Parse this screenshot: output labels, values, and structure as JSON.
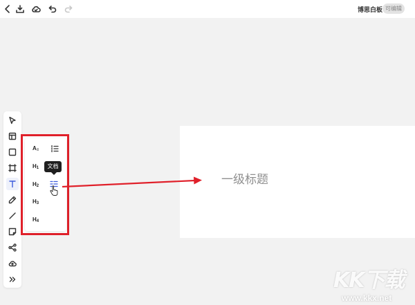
{
  "app": {
    "title": "博思白板",
    "mode_badge": "可编辑"
  },
  "topbar": {
    "icons": [
      "back-icon",
      "download-icon",
      "cloud-icon",
      "undo-icon",
      "redo-icon"
    ]
  },
  "toolbar": {
    "items": [
      "select-icon",
      "frame-icon",
      "shape-icon",
      "crop-icon",
      "text-icon",
      "pen-icon",
      "line-icon",
      "sticky-note-icon",
      "share-icon",
      "upload-icon",
      "more-icon"
    ],
    "active": "text-icon"
  },
  "text_panel": {
    "options": [
      {
        "label": "A",
        "suffix": "≡"
      },
      {
        "label": "H",
        "suffix": "1"
      },
      {
        "label": "H",
        "suffix": "2"
      },
      {
        "label": "H",
        "suffix": "3"
      },
      {
        "label": "H",
        "suffix": "4"
      }
    ],
    "tooltip": "文档"
  },
  "canvas": {
    "heading": "一级标题"
  },
  "watermark": {
    "logo": "KK下载",
    "url": "www.kkx.net"
  },
  "colors": {
    "highlight_red": "#e0202a",
    "active_blue": "#3c5bdc"
  }
}
